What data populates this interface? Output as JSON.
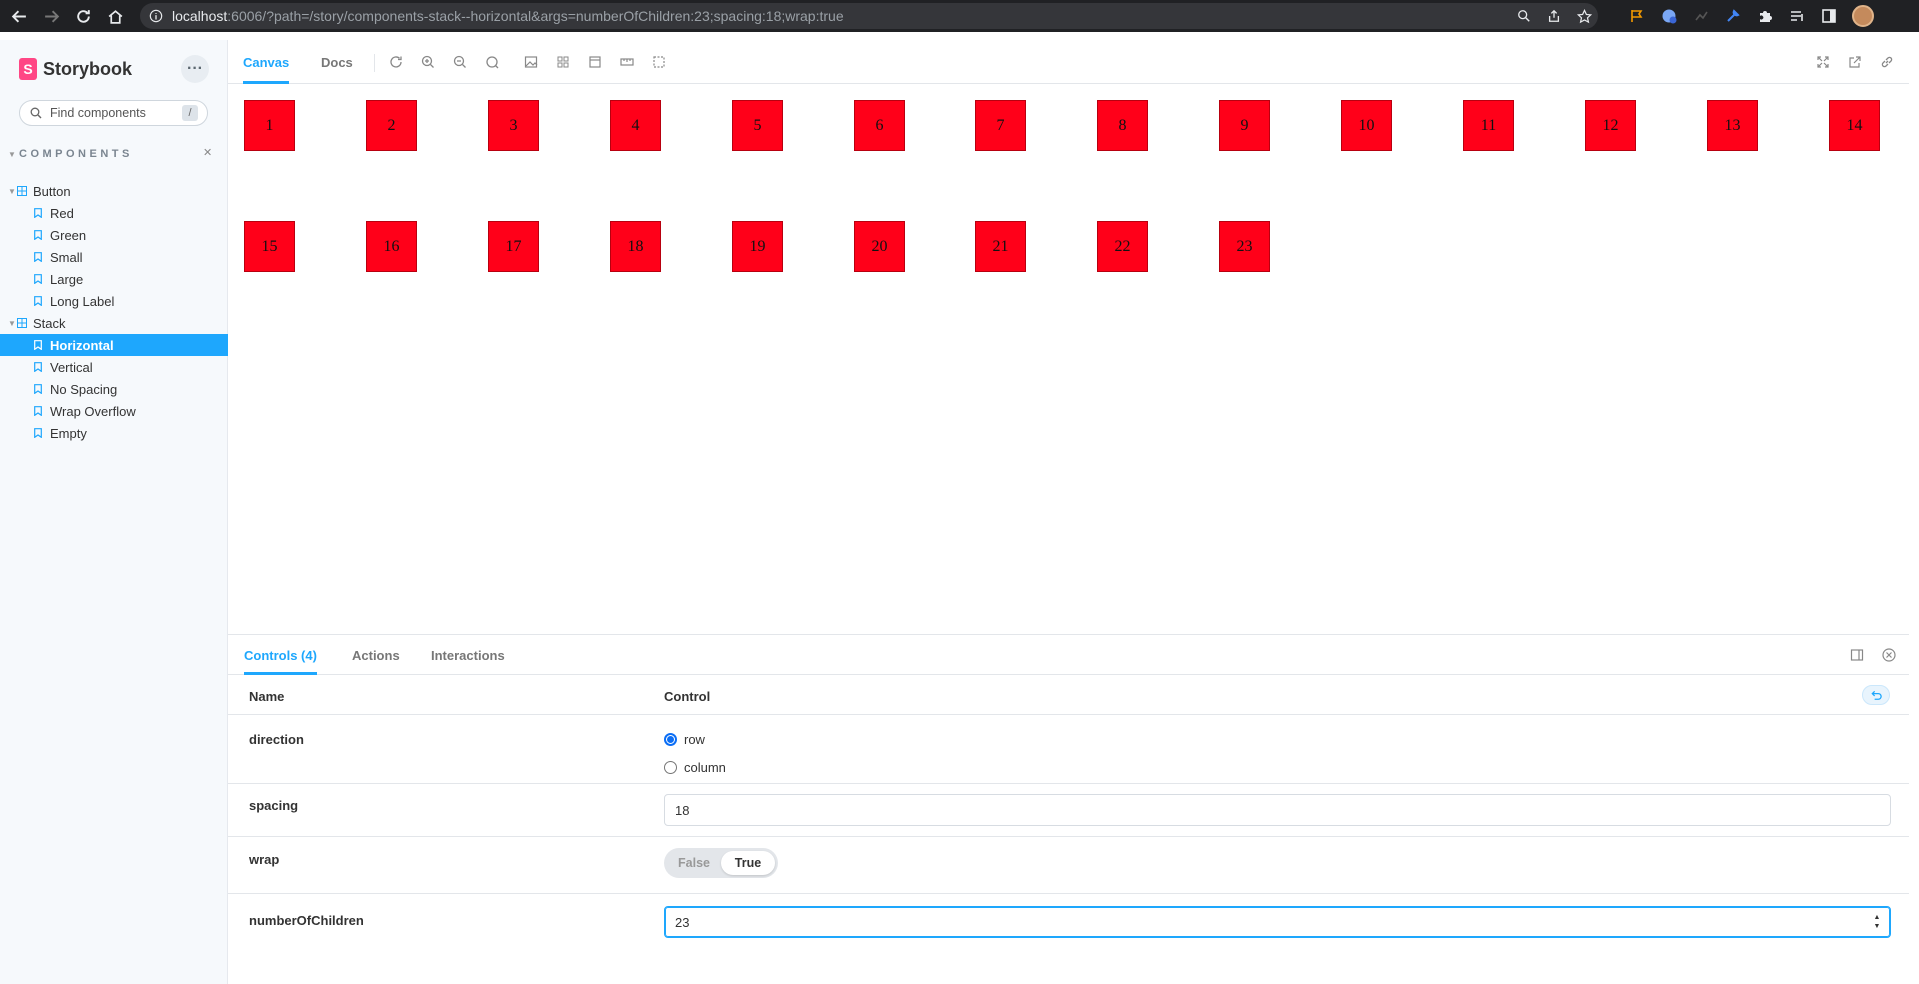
{
  "browser": {
    "url_host": "localhost",
    "url_rest": ":6006/?path=/story/components-stack--horizontal&args=numberOfChildren:23;spacing:18;wrap:true"
  },
  "sidebar": {
    "brand": "Storybook",
    "brand_glyph": "S",
    "menu_glyph": "···",
    "search_placeholder": "Find components",
    "search_shortcut": "/",
    "section_title": "COMPONENTS",
    "groups": [
      {
        "label": "Button",
        "stories": [
          "Red",
          "Green",
          "Small",
          "Large",
          "Long Label"
        ]
      },
      {
        "label": "Stack",
        "stories": [
          "Horizontal",
          "Vertical",
          "No Spacing",
          "Wrap Overflow",
          "Empty"
        ]
      }
    ],
    "selected_story": "Horizontal"
  },
  "toolbar": {
    "tabs": [
      "Canvas",
      "Docs"
    ],
    "active_tab": "Canvas",
    "tool_icons": [
      "refresh-icon",
      "zoom-in-icon",
      "zoom-out-icon",
      "zoom-reset-icon",
      "background-icon",
      "grid-icon",
      "viewport-icon",
      "measure-icon",
      "outline-icon"
    ],
    "right_icons": [
      "fullscreen-icon",
      "open-new-tab-icon",
      "copy-link-icon"
    ]
  },
  "canvas": {
    "box_color": "#ff0019",
    "items": [
      "1",
      "2",
      "3",
      "4",
      "5",
      "6",
      "7",
      "8",
      "9",
      "10",
      "11",
      "12",
      "13",
      "14",
      "15",
      "16",
      "17",
      "18",
      "19",
      "20",
      "21",
      "22",
      "23"
    ]
  },
  "panel": {
    "tabs": [
      "Controls (4)",
      "Actions",
      "Interactions"
    ],
    "active_tab": "Controls (4)",
    "header": {
      "name": "Name",
      "control": "Control"
    },
    "rows": {
      "direction": {
        "name": "direction",
        "options": [
          "row",
          "column"
        ],
        "value": "row"
      },
      "spacing": {
        "name": "spacing",
        "value": "18"
      },
      "wrap": {
        "name": "wrap",
        "options": [
          "False",
          "True"
        ],
        "value": "True"
      },
      "numberOfChildren": {
        "name": "numberOfChildren",
        "value": "23"
      }
    }
  },
  "colors": {
    "accent": "#1ea7fd",
    "brand": "#ff4785",
    "chrome": "#202124"
  }
}
